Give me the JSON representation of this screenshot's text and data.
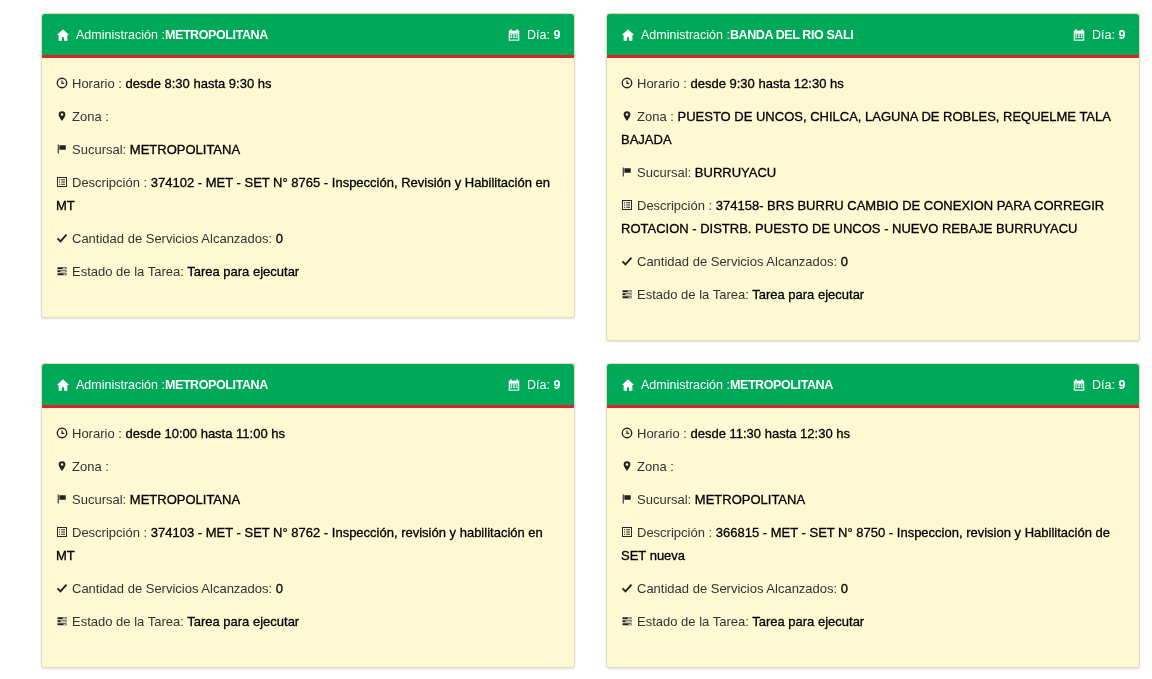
{
  "cards": [
    {
      "admin_label": "Administración :",
      "admin_value": "METROPOLITANA",
      "day_label": "Día:",
      "day_value": "9",
      "fields": [
        {
          "kind": "time",
          "label": "Horario :",
          "value": "desde 8:30 hasta 9:30 hs"
        },
        {
          "kind": "zone",
          "label": "Zona :"
        },
        {
          "kind": "branch",
          "label": "Sucursal:",
          "value": "METROPOLITANA"
        },
        {
          "kind": "description",
          "label": "Descripción :",
          "value": "374102 - MET - SET N° 8765 - Inspección, Revisión y Habilitación en MT"
        },
        {
          "kind": "count",
          "label": "Cantidad de Servicios Alcanzados:",
          "value": "0"
        },
        {
          "kind": "status",
          "label": "Estado de la Tarea:",
          "value": "Tarea para ejecutar"
        }
      ]
    },
    {
      "admin_label": "Administración :",
      "admin_value": "BANDA DEL RIO SALI",
      "day_label": "Día:",
      "day_value": "9",
      "fields": [
        {
          "kind": "time",
          "label": "Horario :",
          "value": "desde 9:30 hasta 12:30 hs"
        },
        {
          "kind": "zone",
          "label": "Zona :",
          "value": "PUESTO DE UNCOS, CHILCA, LAGUNA DE ROBLES, REQUELME TALA BAJADA"
        },
        {
          "kind": "branch",
          "label": "Sucursal:",
          "value": "BURRUYACU"
        },
        {
          "kind": "description",
          "label": "Descripción :",
          "value": "374158- BRS BURRU CAMBIO DE CONEXION PARA CORREGIR ROTACION - DISTRB. PUESTO DE UNCOS - NUEVO REBAJE BURRUYACU"
        },
        {
          "kind": "count",
          "label": "Cantidad de Servicios Alcanzados:",
          "value": "0"
        },
        {
          "kind": "status",
          "label": "Estado de la Tarea:",
          "value": "Tarea para ejecutar"
        }
      ]
    },
    {
      "admin_label": "Administración :",
      "admin_value": "METROPOLITANA",
      "day_label": "Día:",
      "day_value": "9",
      "fields": [
        {
          "kind": "time",
          "label": "Horario :",
          "value": "desde 10:00 hasta 11:00 hs"
        },
        {
          "kind": "zone",
          "label": "Zona :"
        },
        {
          "kind": "branch",
          "label": "Sucursal:",
          "value": "METROPOLITANA"
        },
        {
          "kind": "description",
          "label": "Descripción :",
          "value": "374103 - MET - SET N° 8762 - Inspección, revisión y habilitación en MT"
        },
        {
          "kind": "count",
          "label": "Cantidad de Servicios Alcanzados:",
          "value": "0"
        },
        {
          "kind": "status",
          "label": "Estado de la Tarea:",
          "value": "Tarea para ejecutar"
        }
      ]
    },
    {
      "admin_label": "Administración :",
      "admin_value": "METROPOLITANA",
      "day_label": "Día:",
      "day_value": "9",
      "fields": [
        {
          "kind": "time",
          "label": "Horario :",
          "value": "desde 11:30 hasta 12:30 hs"
        },
        {
          "kind": "zone",
          "label": "Zona :"
        },
        {
          "kind": "branch",
          "label": "Sucursal:",
          "value": "METROPOLITANA"
        },
        {
          "kind": "description",
          "label": "Descripción :",
          "value": "366815 - MET - SET N° 8750 - Inspeccion, revision y Habilitación de SET nueva"
        },
        {
          "kind": "count",
          "label": "Cantidad de Servicios Alcanzados:",
          "value": "0"
        },
        {
          "kind": "status",
          "label": "Estado de la Tarea:",
          "value": "Tarea para ejecutar"
        }
      ]
    }
  ]
}
